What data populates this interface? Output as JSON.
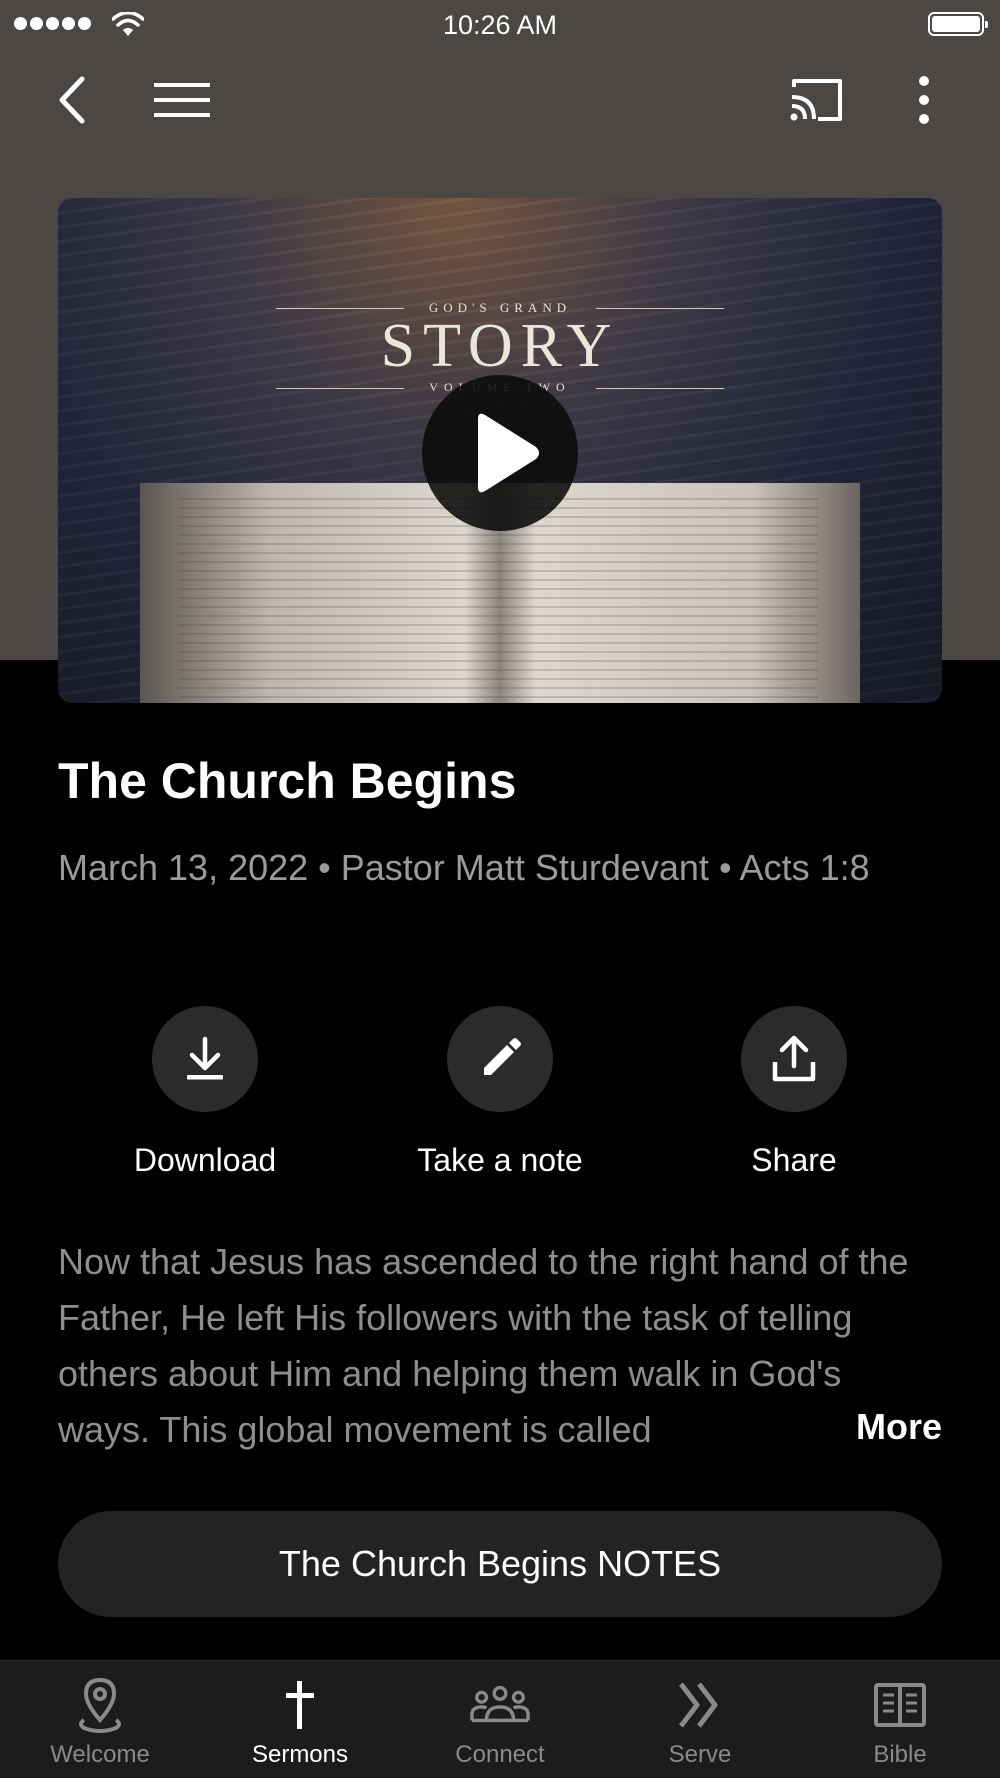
{
  "status_bar": {
    "time": "10:26 AM"
  },
  "nav": {
    "back_icon": "chevron-left-icon",
    "menu_icon": "hamburger-icon",
    "cast_icon": "cast-icon",
    "more_icon": "more-vertical-icon"
  },
  "hero": {
    "series_eyebrow": "GOD'S GRAND",
    "series_title": "STORY",
    "series_subtitle": "VOLUME TWO",
    "play_icon": "play-icon"
  },
  "sermon": {
    "title": "The Church Begins",
    "meta": "March 13, 2022 • Pastor Matt Sturdevant • Acts 1:8",
    "description": "Now that Jesus has ascended to the right hand of the Father, He left His followers with the task of telling others about Him and helping them walk in God's ways.  This global movement is called",
    "more_label": "More",
    "notes_button": "The Church Begins NOTES"
  },
  "actions": [
    {
      "label": "Download",
      "icon": "download-icon"
    },
    {
      "label": "Take a note",
      "icon": "pencil-icon"
    },
    {
      "label": "Share",
      "icon": "share-icon"
    }
  ],
  "tabs": [
    {
      "label": "Welcome",
      "icon": "map-pin-icon",
      "active": false
    },
    {
      "label": "Sermons",
      "icon": "cross-icon",
      "active": true
    },
    {
      "label": "Connect",
      "icon": "people-icon",
      "active": false
    },
    {
      "label": "Serve",
      "icon": "double-chevron-icon",
      "active": false
    },
    {
      "label": "Bible",
      "icon": "book-icon",
      "active": false
    }
  ],
  "colors": {
    "header_bg": "#4a4744",
    "page_bg": "#000000",
    "button_bg": "#2b2b2b",
    "tab_bar_bg": "#1c1c1c",
    "muted_text": "#9b9b9b"
  }
}
